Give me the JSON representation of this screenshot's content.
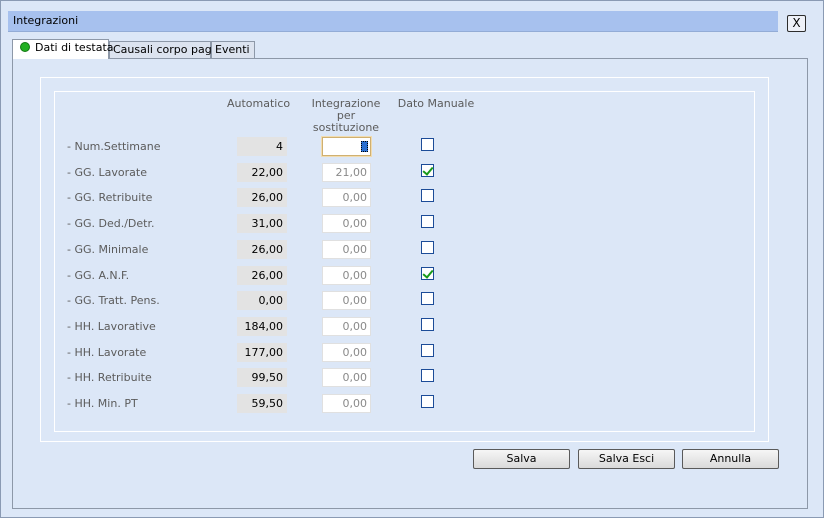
{
  "window": {
    "title": "Integrazioni",
    "close_label": "X"
  },
  "tabs": [
    {
      "label": "Dati di testata",
      "active": true,
      "status_color": "#22b022"
    },
    {
      "label": "Causali corpo paga",
      "active": false
    },
    {
      "label": "Eventi",
      "active": false
    }
  ],
  "columns": {
    "automatico": "Automatico",
    "integrazione_line1": "Integrazione per",
    "integrazione_line2": "sostituzione",
    "dato_manuale": "Dato Manuale"
  },
  "rows": [
    {
      "label": "- Num.Settimane",
      "automatico": "4",
      "integrazione": "",
      "manuale": false
    },
    {
      "label": "- GG. Lavorate",
      "automatico": "22,00",
      "integrazione": "21,00",
      "manuale": true
    },
    {
      "label": "- GG. Retribuite",
      "automatico": "26,00",
      "integrazione": "0,00",
      "manuale": false
    },
    {
      "label": "- GG. Ded./Detr.",
      "automatico": "31,00",
      "integrazione": "0,00",
      "manuale": false
    },
    {
      "label": "- GG. Minimale",
      "automatico": "26,00",
      "integrazione": "0,00",
      "manuale": false
    },
    {
      "label": "- GG. A.N.F.",
      "automatico": "26,00",
      "integrazione": "0,00",
      "manuale": true
    },
    {
      "label": "- GG. Tratt. Pens.",
      "automatico": "0,00",
      "integrazione": "0,00",
      "manuale": false
    },
    {
      "label": "- HH. Lavorative",
      "automatico": "184,00",
      "integrazione": "0,00",
      "manuale": false
    },
    {
      "label": "- HH. Lavorate",
      "automatico": "177,00",
      "integrazione": "0,00",
      "manuale": false
    },
    {
      "label": "- HH. Retribuite",
      "automatico": "99,50",
      "integrazione": "0,00",
      "manuale": false
    },
    {
      "label": "- HH. Min. PT",
      "automatico": "59,50",
      "integrazione": "0,00",
      "manuale": false
    }
  ],
  "buttons": {
    "salva": "Salva",
    "salva_esci": "Salva Esci",
    "annulla": "Annulla"
  }
}
